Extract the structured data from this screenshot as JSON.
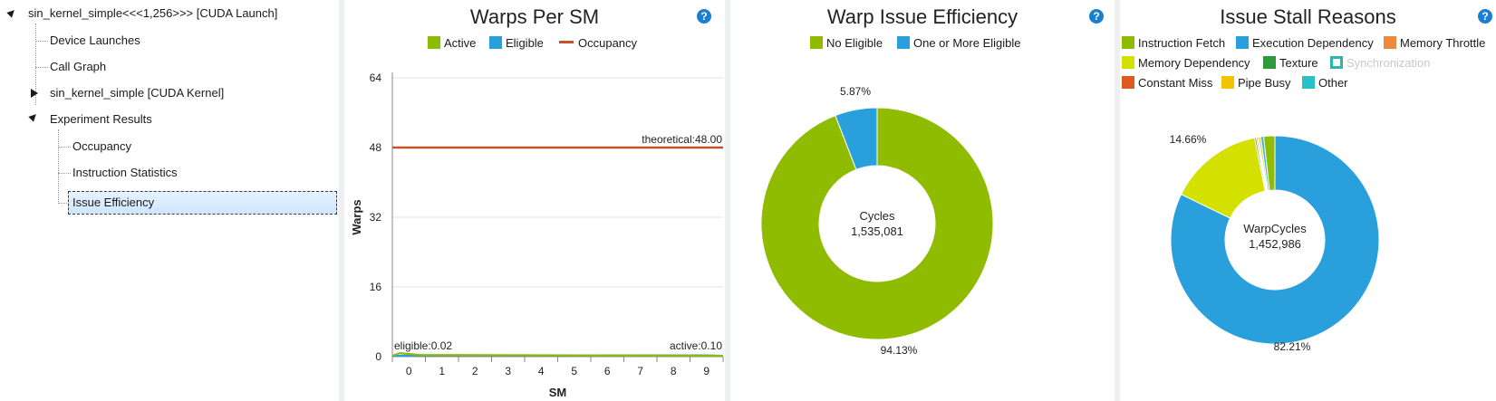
{
  "tree": {
    "items": [
      {
        "label": "sin_kernel_simple<<<1,256>>> [CUDA Launch]"
      },
      {
        "label": "Device Launches"
      },
      {
        "label": "Call Graph"
      },
      {
        "label": "sin_kernel_simple [CUDA Kernel]"
      },
      {
        "label": "Experiment Results"
      },
      {
        "label": "Occupancy"
      },
      {
        "label": "Instruction Statistics"
      },
      {
        "label": "Issue Efficiency"
      }
    ]
  },
  "help_glyph": "?",
  "chart_data": [
    {
      "type": "line",
      "title": "Warps Per SM",
      "xlabel": "SM",
      "ylabel": "Warps",
      "x": [
        0,
        1,
        2,
        3,
        4,
        5,
        6,
        7,
        8,
        9
      ],
      "ylim": [
        0,
        64
      ],
      "yticks": [
        0,
        16,
        32,
        48,
        64
      ],
      "grid": true,
      "legend_position": "top",
      "series": [
        {
          "name": "Active",
          "color": "#8fbc00",
          "values": [
            0.1,
            0.1,
            0.1,
            0.1,
            0.1,
            0.1,
            0.1,
            0.1,
            0.1,
            0.1
          ],
          "annotation": "active:0.10"
        },
        {
          "name": "Eligible",
          "color": "#29a0dc",
          "values": [
            0.02,
            0.02,
            0.02,
            0.02,
            0.02,
            0.02,
            0.02,
            0.02,
            0.02,
            0.02
          ],
          "annotation": "eligible:0.02"
        },
        {
          "name": "Occupancy",
          "color": "#c0532a",
          "values": [
            48,
            48,
            48,
            48,
            48,
            48,
            48,
            48,
            48,
            48
          ],
          "annotation": "theoretical:48.00"
        }
      ]
    },
    {
      "type": "pie",
      "donut": true,
      "title": "Warp Issue Efficiency",
      "center_label": "Cycles",
      "center_value": "1,535,081",
      "legend_position": "top",
      "slices": [
        {
          "name": "No Eligible",
          "value": 94.13,
          "label": "94.13%",
          "color": "#8fbc00"
        },
        {
          "name": "One or More Eligible",
          "value": 5.87,
          "label": "5.87%",
          "color": "#29a0dc"
        }
      ]
    },
    {
      "type": "pie",
      "donut": true,
      "title": "Issue Stall Reasons",
      "center_label": "WarpCycles",
      "center_value": "1,452,986",
      "legend_position": "top",
      "slices": [
        {
          "name": "Execution Dependency",
          "value": 82.21,
          "label": "82.21%",
          "color": "#29a0dc"
        },
        {
          "name": "Memory Dependency",
          "value": 14.66,
          "label": "14.66%",
          "color": "#d4e000"
        },
        {
          "name": "Texture",
          "value": 0.25,
          "label": "",
          "color": "#2e9a3c"
        },
        {
          "name": "Constant Miss",
          "value": 0.2,
          "label": "",
          "color": "#e05a20"
        },
        {
          "name": "Memory Throttle",
          "value": 0.2,
          "label": "",
          "color": "#ef8a3a"
        },
        {
          "name": "Pipe Busy",
          "value": 0.3,
          "label": "",
          "color": "#f2c400"
        },
        {
          "name": "Other",
          "value": 0.45,
          "label": "",
          "color": "#2bc0c8"
        },
        {
          "name": "Synchronization",
          "value": 0.0,
          "label": "",
          "color": "#2bb5ae",
          "disabled": true
        },
        {
          "name": "Instruction Fetch",
          "value": 1.73,
          "label": "",
          "color": "#8fbc00"
        }
      ]
    }
  ]
}
